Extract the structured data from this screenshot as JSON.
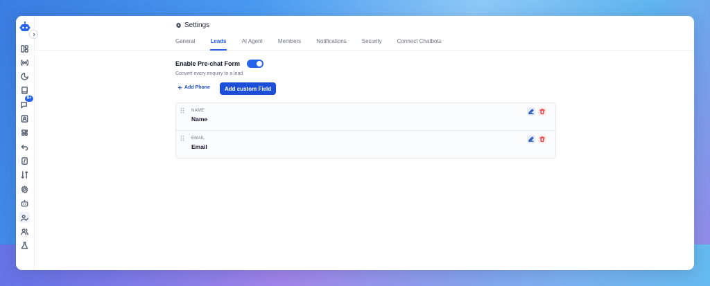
{
  "page": {
    "title": "Settings"
  },
  "tabs": [
    "General",
    "Leads",
    "AI Agent",
    "Members",
    "Notifications",
    "Security",
    "Connect Chatbots"
  ],
  "active_tab": "Leads",
  "sidebar": {
    "badge": "9+",
    "icons": [
      "dashboard-icon",
      "broadcast-icon",
      "analytics-icon",
      "book-icon",
      "chat-icon",
      "contacts-icon",
      "integrations-icon",
      "undo-icon",
      "document-icon",
      "workflow-icon",
      "settings-icon",
      "bot-icon",
      "lead-user-icon",
      "team-icon",
      "flask-icon"
    ]
  },
  "leads": {
    "form_title": "Enable Pre-chat Form",
    "form_subtitle": "Convert every enquiry to a lead",
    "toggle_on": true,
    "add_phone_label": "Add Phone",
    "add_custom_label": "Add custom Field",
    "fields": [
      {
        "key": "NAME",
        "label": "Name"
      },
      {
        "key": "EMAIL",
        "label": "Email"
      }
    ]
  },
  "colors": {
    "accent": "#2563eb",
    "delete": "#ef4444"
  }
}
